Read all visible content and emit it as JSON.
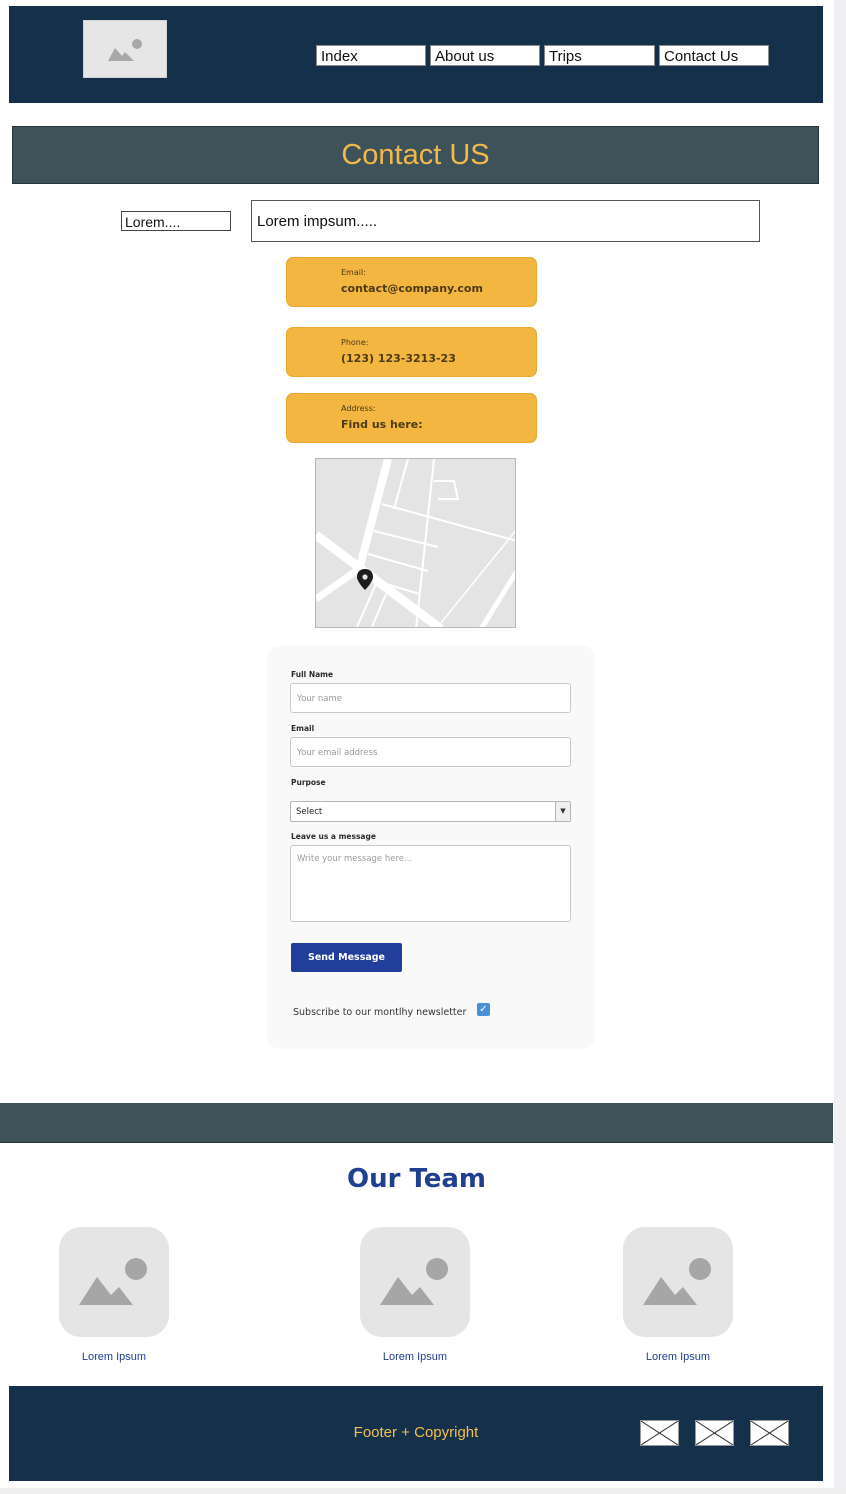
{
  "nav": {
    "items": [
      {
        "label": "Index"
      },
      {
        "label": "About us"
      },
      {
        "label": "Trips"
      },
      {
        "label": "Contact Us"
      }
    ]
  },
  "page": {
    "title": "Contact US",
    "small_field_value": "Lorem....",
    "large_field_value": "Lorem impsum....."
  },
  "contact": {
    "email": {
      "label": "Email:",
      "value": "contact@company.com"
    },
    "phone": {
      "label": "Phone:",
      "value": "(123) 123-3213-23"
    },
    "address": {
      "label": "Address:",
      "value": "Find us here:"
    }
  },
  "form": {
    "full_name_label": "Full Name",
    "full_name_placeholder": "Your name",
    "email_label": "Email",
    "email_placeholder": "Your email address",
    "purpose_label": "Purpose",
    "purpose_selected": "Select",
    "message_label": "Leave us a message",
    "message_placeholder": "Write your message here...",
    "send_label": "Send Message",
    "subscribe_label": "Subscribe to our montlhy newsletter",
    "subscribe_checked": true
  },
  "team": {
    "title": "Our Team",
    "members": [
      {
        "name": "Lorem Ipsum"
      },
      {
        "name": "Lorem Ipsum"
      },
      {
        "name": "Lorem Ipsum"
      }
    ]
  },
  "footer": {
    "text": "Footer + Copyright",
    "social_icons": [
      "image-placeholder-icon",
      "image-placeholder-icon",
      "image-placeholder-icon"
    ]
  },
  "colors": {
    "header_bg": "#15304a",
    "band_bg": "#3d5259",
    "accent_yellow": "#f3b640",
    "title_text": "#f2b84b",
    "primary_blue": "#213f9a",
    "team_blue": "#1f3f8f"
  }
}
